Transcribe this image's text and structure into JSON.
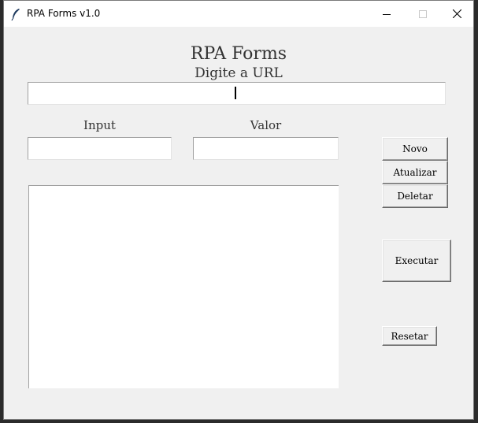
{
  "window": {
    "title": "RPA Forms v1.0"
  },
  "app": {
    "title": "RPA Forms",
    "url_label": "Digite a URL",
    "url_value": ""
  },
  "fields": {
    "input_label": "Input",
    "valor_label": "Valor",
    "input_value": "",
    "valor_value": ""
  },
  "buttons": {
    "novo": "Novo",
    "atualizar": "Atualizar",
    "deletar": "Deletar",
    "executar": "Executar",
    "resetar": "Resetar"
  },
  "listbox": {
    "items": []
  }
}
